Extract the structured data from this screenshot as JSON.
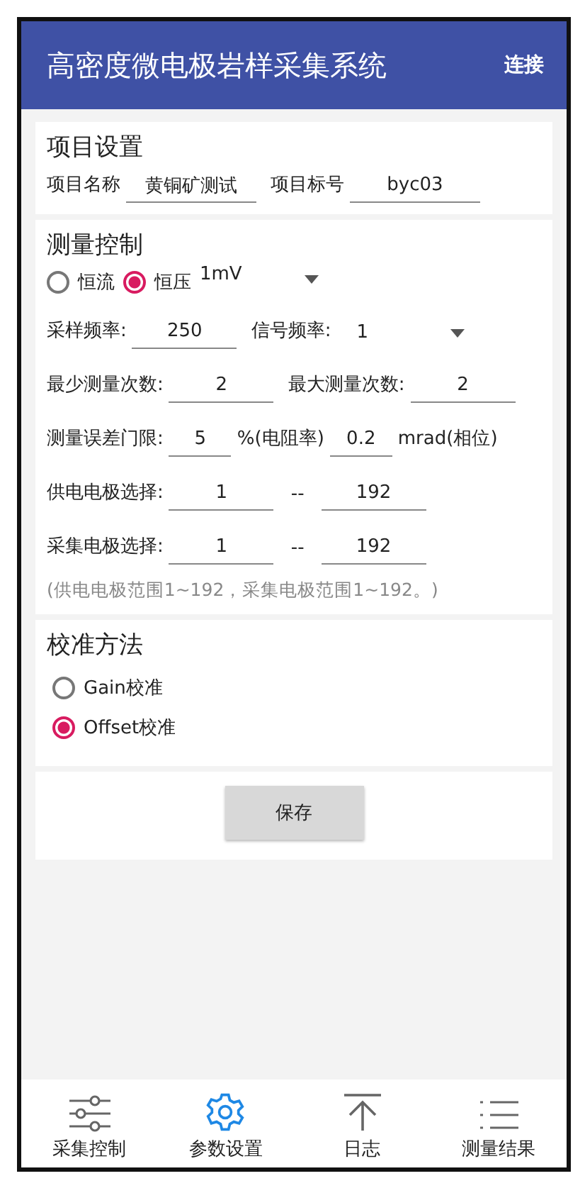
{
  "app_bar": {
    "title": "高密度微电极岩样采集系统",
    "action": "连接"
  },
  "project": {
    "heading": "项目设置",
    "fields": [
      {
        "label": "项目名称",
        "value": "黄铜矿测试"
      },
      {
        "label": "项目标号",
        "value": "byc03"
      }
    ]
  },
  "measurement": {
    "heading": "测量控制",
    "modes": [
      {
        "label": "恒流",
        "selected": false
      },
      {
        "label": "恒压",
        "selected": true
      }
    ],
    "voltage": "1mV",
    "sample_rate": {
      "label": "采样频率:",
      "value": "250"
    },
    "signal_freq": {
      "label": "信号频率:",
      "value": "1"
    },
    "min_count": {
      "label": "最少测量次数:",
      "value": "2"
    },
    "max_count": {
      "label": "最大测量次数:",
      "value": "2"
    },
    "error_limit": {
      "label": "测量误差门限:",
      "resistivity": "5",
      "resistivity_unit": "%(电阻率)",
      "phase": "0.2",
      "phase_unit": "mrad(相位)"
    },
    "ranges": [
      {
        "label": "供电电极选择:",
        "from": "1",
        "separator": "--",
        "to": "192"
      },
      {
        "label": "采集电极选择:",
        "from": "1",
        "separator": "--",
        "to": "192"
      }
    ],
    "note": "(供电电极范围1~192，采集电极范围1~192。)"
  },
  "calibration": {
    "heading": "校准方法",
    "options": [
      {
        "label": "Gain校准",
        "selected": false
      },
      {
        "label": "Offset校准",
        "selected": true
      }
    ]
  },
  "save_button": "保存",
  "nav": [
    {
      "label": "采集控制",
      "kind": "sliders",
      "selected": false
    },
    {
      "label": "参数设置",
      "kind": "gear",
      "selected": true
    },
    {
      "label": "日志",
      "kind": "upload",
      "selected": false
    },
    {
      "label": "测量结果",
      "kind": "list",
      "selected": false
    }
  ]
}
